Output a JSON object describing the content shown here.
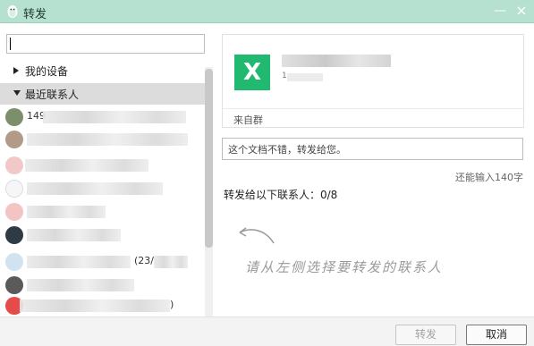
{
  "window": {
    "title": "转发",
    "minimize": "—",
    "close": "×"
  },
  "left": {
    "search": {
      "value": "",
      "placeholder": ""
    },
    "groups": [
      {
        "label": "我的设备",
        "expanded": false
      },
      {
        "label": "最近联系人",
        "expanded": true
      }
    ],
    "contacts": [
      {
        "name": "149",
        "avatar_color": "#7a8f6a"
      },
      {
        "name": "",
        "avatar_color": "#b39a87"
      },
      {
        "name": "",
        "avatar_color": "#f1c9c9"
      },
      {
        "name": "",
        "avatar_color": "#dcdcdc"
      },
      {
        "name": "",
        "avatar_color": "#f2c4c4"
      },
      {
        "name": "",
        "avatar_color": "#2e3b44"
      },
      {
        "name": "(23/",
        "avatar_color": "#cfe3f0"
      },
      {
        "name": "",
        "avatar_color": "#5a5a5a"
      },
      {
        "name": ")",
        "avatar_color": "#e44b4b"
      }
    ]
  },
  "file_card": {
    "icon_letter": "X",
    "icon_color": "#21b96f",
    "size_prefix": "1",
    "source": "来自群"
  },
  "message": {
    "value": "这个文档不错，转发给您。",
    "remaining": "还能输入140字"
  },
  "forward_to": "转发给以下联系人：0/8",
  "hint": "请从左侧选择要转发的联系人",
  "buttons": {
    "forward": "转发",
    "cancel": "取消"
  }
}
